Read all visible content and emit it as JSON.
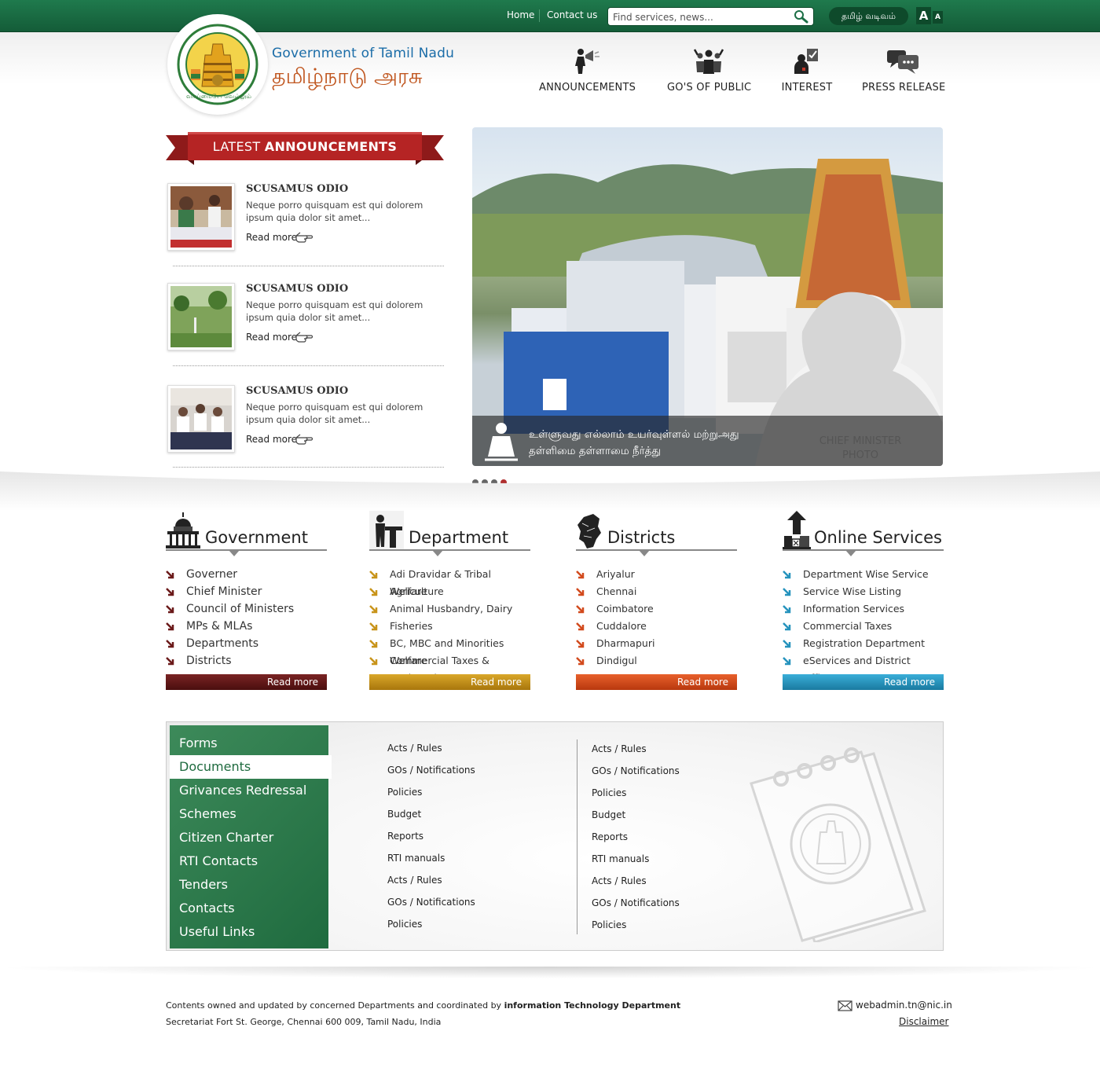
{
  "topbar": {
    "home": "Home",
    "contact": "Contact us",
    "search_placeholder": "Find services, news...",
    "tamil_version": "தமிழ் வடிவம்",
    "font_large": "A",
    "font_small": "A"
  },
  "header": {
    "title_en": "Government of Tamil Nadu",
    "title_ta": "தமிழ்நாடு அரசு",
    "emblem_text": "வாய்மையே வெல்லும்",
    "nav": [
      {
        "label": "ANNOUNCEMENTS",
        "icon": "megaphone-icon"
      },
      {
        "label": "GO'S OF PUBLIC",
        "icon": "people-icon"
      },
      {
        "label": "INTEREST",
        "icon": "person-check-icon"
      },
      {
        "label": "PRESS RELEASE",
        "icon": "chat-bubbles-icon"
      }
    ]
  },
  "announcements": {
    "heading_light": "LATEST",
    "heading_bold": "ANNOUNCEMENTS",
    "items": [
      {
        "title": "SCUSAMUS ODIO",
        "text": "Neque porro quisquam est qui dolorem ipsum quia dolor sit amet...",
        "more": "Read more"
      },
      {
        "title": "SCUSAMUS ODIO",
        "text": "Neque porro quisquam est qui dolorem ipsum quia dolor sit amet...",
        "more": "Read more"
      },
      {
        "title": "SCUSAMUS ODIO",
        "text": "Neque porro quisquam est qui dolorem ipsum quia dolor sit amet...",
        "more": "Read more"
      }
    ]
  },
  "slider": {
    "caption_line1": "உள்ளுவது எல்லாம் உயர்வுள்ளல் மற்றுஅது",
    "caption_line2": "தள்ளிமை தள்ளாமை நீர்த்து",
    "cm_photo_line1": "CHIEF MINISTER",
    "cm_photo_line2": "PHOTO",
    "slide_count": 4,
    "active_slide": 4
  },
  "columns": [
    {
      "title": "Government",
      "color": "#6b1a1a",
      "items": [
        "Governer",
        "Chief Minister",
        "Council of Ministers",
        "MPs & MLAs",
        "Departments",
        "Districts"
      ],
      "more": "Read more"
    },
    {
      "title": "Department",
      "color": "#c8941a",
      "items": [
        "Adi Dravidar & Tribal Welfare",
        "Agriculture",
        "Animal Husbandry, Dairy",
        "Fisheries",
        "BC, MBC and Minorities Welfare",
        "Commercial Taxes & Registration"
      ],
      "more": "Read more"
    },
    {
      "title": "Districts",
      "color": "#d24a1d",
      "items": [
        "Ariyalur",
        "Chennai",
        "Coimbatore",
        "Cuddalore",
        "Dharmapuri",
        "Dindigul"
      ],
      "more": "Read more"
    },
    {
      "title": "Online Services",
      "color": "#2693bd",
      "items": [
        "Department Wise Service",
        "Service Wise Listing",
        "Information Services",
        "Commercial Taxes",
        "Registration Department",
        "eServices and District Officers"
      ],
      "more": "Read more"
    }
  ],
  "panel": {
    "menu": [
      "Forms",
      "Documents",
      "Grivances Redressal",
      "Schemes",
      "Citizen Charter",
      "RTI Contacts",
      "Tenders",
      "Contacts",
      "Useful Links"
    ],
    "active_menu": "Documents",
    "links_left": [
      "Acts / Rules",
      "GOs / Notifications",
      "Policies",
      "Budget",
      "Reports",
      "RTI manuals",
      "Acts / Rules",
      "GOs / Notifications",
      "Policies"
    ],
    "links_right": [
      "Acts / Rules",
      "GOs / Notifications",
      "Policies",
      "Budget",
      "Reports",
      "RTI manuals",
      "Acts / Rules",
      "GOs / Notifications",
      "Policies"
    ]
  },
  "footer": {
    "line1_prefix": "Contents owned and updated by concerned Departments and coordinated by",
    "line1_bold": "information Technology Department",
    "line2": "Secretariat Fort St. George, Chennai 600 009, Tamil Nadu, India",
    "email": "webadmin.tn@nic.in",
    "disclaimer": "Disclaimer"
  }
}
